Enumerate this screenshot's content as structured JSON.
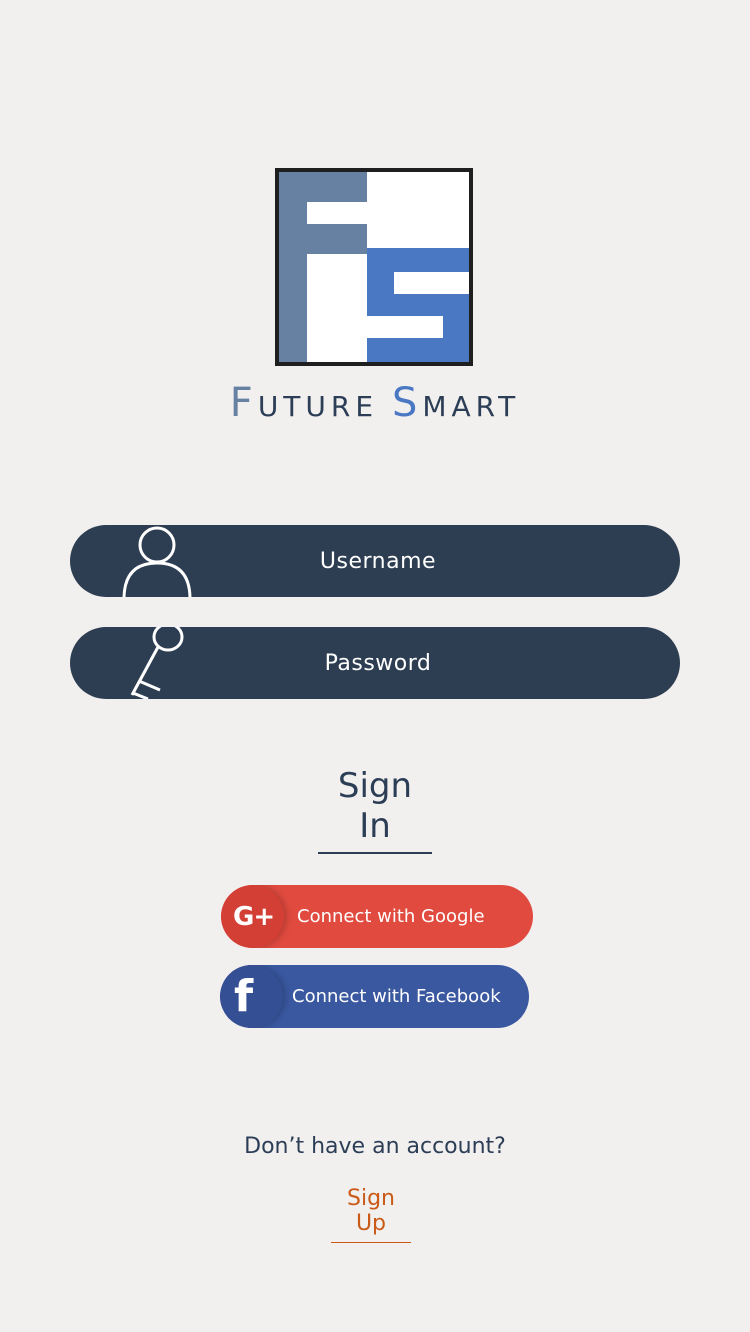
{
  "brand": {
    "name_f": "F",
    "name_uture": "UTURE",
    "name_s": "S",
    "name_mart": "MART"
  },
  "login": {
    "username_placeholder": "Username",
    "password_placeholder": "Password",
    "signin_label": "Sign In"
  },
  "social": {
    "google_label": "Connect with Google",
    "google_icon_text": "G+",
    "facebook_label": "Connect with Facebook",
    "facebook_icon_text": "f"
  },
  "footer": {
    "question": "Don’t have an account?",
    "signup_label": "Sign Up"
  },
  "colors": {
    "background": "#f2efef",
    "field": "#2d3e52",
    "google": "#e04a3f",
    "facebook": "#3a58a0",
    "signup": "#c95a17"
  }
}
